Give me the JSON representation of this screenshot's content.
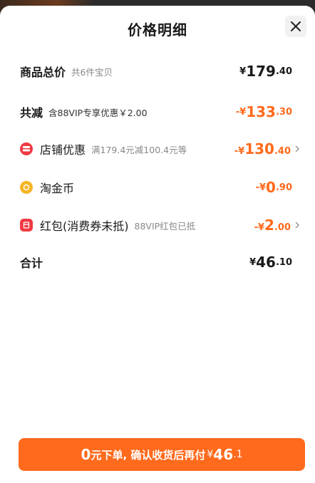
{
  "sheet": {
    "title": "价格明细",
    "close_icon": "close-icon"
  },
  "rows": [
    {
      "label": "商品总价",
      "sub": "共6件宝贝",
      "yen": "¥",
      "int": "179",
      "dec": ".40"
    },
    {
      "label": "共减",
      "sub": "含88VIP专享优惠￥2.00",
      "yen": "-¥",
      "int": "133",
      "dec": ".30"
    },
    {
      "label": "店铺优惠",
      "sub": "满179.4元减100.4元等",
      "yen": "-¥",
      "int": "130",
      "dec": ".40",
      "icon": "store-coupon-icon"
    },
    {
      "label": "淘金币",
      "sub": "",
      "yen": "-¥",
      "int": "0",
      "dec": ".90",
      "icon": "gold-coin-icon"
    },
    {
      "label": "红包(消费券未抵)",
      "sub": "88VIP红包已抵",
      "yen": "-¥",
      "int": "2",
      "dec": ".00",
      "icon": "red-packet-icon"
    },
    {
      "label": "合计",
      "sub": "",
      "yen": "¥",
      "int": "46",
      "dec": ".10"
    }
  ],
  "cta": {
    "num": "0",
    "text": "元下单, 确认收货后再付",
    "yen": "¥",
    "int": "46",
    "dec": ".1"
  },
  "colors": {
    "accent": "#ff6a1c",
    "red": "#f03a43",
    "gold": "#f6b526"
  }
}
